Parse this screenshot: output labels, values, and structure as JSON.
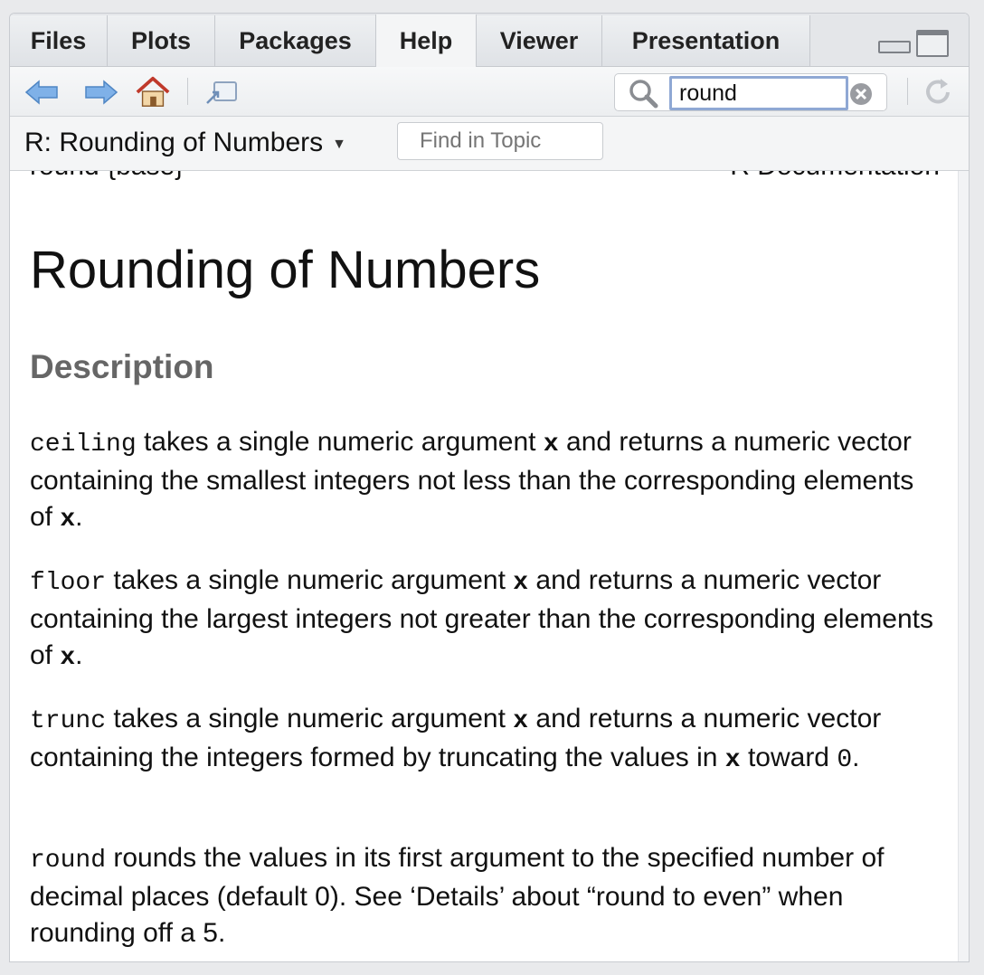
{
  "tabs": [
    "Files",
    "Plots",
    "Packages",
    "Help",
    "Viewer",
    "Presentation"
  ],
  "active_tab": "Help",
  "search": {
    "value": "round"
  },
  "topic": {
    "title": "R: Rounding of Numbers",
    "find_placeholder": "Find in Topic"
  },
  "doc": {
    "header_left": "round {base}",
    "header_right": "R Documentation",
    "title": "Rounding of Numbers",
    "section": "Description",
    "paragraphs": [
      {
        "code": "ceiling",
        "t1": " takes a single numeric argument ",
        "c2": "x",
        "t2": " and returns a numeric vector containing the smallest integers not less than the corresponding elements of ",
        "c3": "x",
        "t3": "."
      },
      {
        "code": "floor",
        "t1": " takes a single numeric argument ",
        "c2": "x",
        "t2": " and returns a numeric vector containing the largest integers not greater than the corresponding elements of ",
        "c3": "x",
        "t3": "."
      },
      {
        "code": "trunc",
        "t1": " takes a single numeric argument ",
        "c2": "x",
        "t2": " and returns a numeric vector containing the integers formed by truncating the values in ",
        "c3": "x",
        "t3": " toward ",
        "c4": "0",
        "t4": "."
      },
      {
        "code": "round",
        "t1": " rounds the values in its first argument to the specified number of decimal places (default 0). See ‘Details’ about “round to even” when rounding off a 5."
      }
    ]
  },
  "colors": {
    "tab_bg": "#e4e6e9",
    "accent_blue": "#6fa3dd",
    "home_red": "#c0392b",
    "search_focus": "#8fa8d4"
  }
}
